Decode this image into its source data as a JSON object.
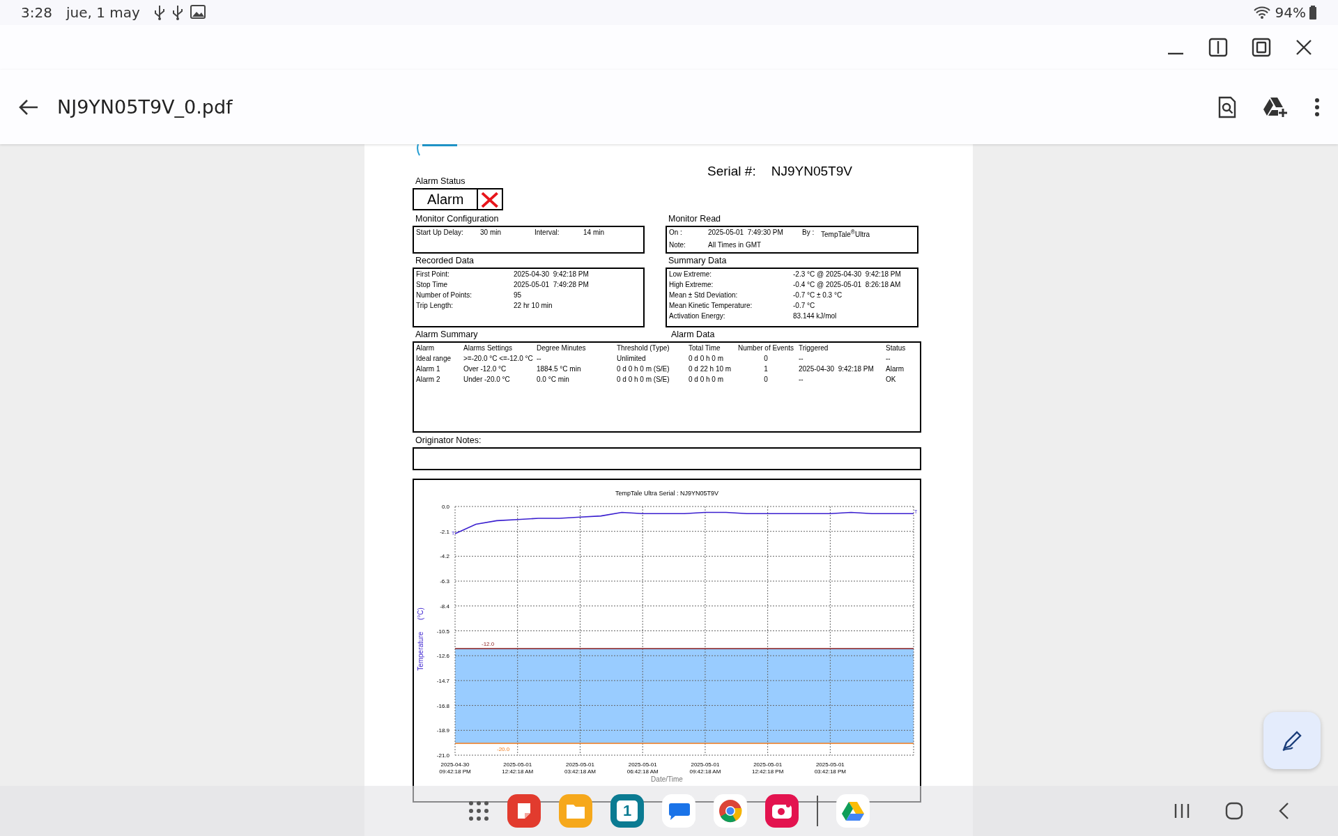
{
  "status_bar": {
    "time": "3:28",
    "date": "jue, 1 may",
    "battery": "94%"
  },
  "toolbar": {
    "title": "NJ9YN05T9V_0.pdf"
  },
  "document": {
    "serial_label": "Serial #:",
    "serial": "NJ9YN05T9V",
    "alarm_status": {
      "heading": "Alarm Status",
      "value": "Alarm"
    },
    "panels": [
      {
        "heading": "Monitor Configuration",
        "rows": [
          [
            {
              "label": "Start Up Delay:",
              "value": "30 min"
            },
            {
              "label": "Interval:",
              "value": "14 min"
            }
          ]
        ]
      },
      {
        "heading": "Monitor Read",
        "rows": [
          [
            {
              "label": "On :",
              "value": "2025-05-01  7:49:30 PM"
            },
            {
              "label": "By :",
              "value": "TempTale$^{®}$Ultra"
            }
          ],
          [
            {
              "label": "Note:",
              "value": "All Times in GMT"
            }
          ]
        ]
      },
      {
        "heading": "Recorded Data",
        "rows": [
          [
            {
              "label": "First Point:",
              "value": "2025-04-30  9:42:18 PM"
            }
          ],
          [
            {
              "label": "Stop Time",
              "value": "2025-05-01  7:49:28 PM"
            }
          ],
          [
            {
              "label": "Number of Points:",
              "value": "95"
            }
          ],
          [
            {
              "label": "Trip Length:",
              "value": "22 hr 10 min"
            }
          ]
        ]
      },
      {
        "heading": "Summary Data",
        "rows": [
          [
            {
              "label": "Low Extreme:",
              "value": "-2.3 °C @ 2025-04-30  9:42:18 PM"
            }
          ],
          [
            {
              "label": "High Extreme:",
              "value": "-0.4 °C @ 2025-05-01  8:26:18 AM"
            }
          ],
          [
            {
              "label": "Mean ± Std Deviation:",
              "value": "-0.7 °C ± 0.3 °C"
            }
          ],
          [
            {
              "label": "Mean Kinetic Temperature:",
              "value": "-0.7 °C"
            }
          ],
          [
            {
              "label": "Activation Energy:",
              "value": "83.144 kJ/mol"
            }
          ]
        ]
      }
    ],
    "alarm_summary": {
      "heading": "Alarm Summary",
      "heading_2": "Alarm Data",
      "columns": [
        "Alarm",
        "Alarms Settings",
        "Degree Minutes",
        "Threshold (Type)",
        "Total Time",
        "Number of Events",
        "Triggered",
        "Status"
      ],
      "rows": [
        [
          "Ideal range",
          ">=-20.0 °C <=-12.0 °C",
          "--",
          "Unlimited",
          "0 d 0 h 0 m",
          "0",
          "--",
          "--"
        ],
        [
          "Alarm 1",
          "Over -12.0 °C",
          "1884.5 °C min",
          "0 d 0 h 0 m (S/E)",
          "0 d 22 h 10 m",
          "1",
          "2025-04-30  9:42:18 PM",
          "Alarm"
        ],
        [
          "Alarm 2",
          "Under -20.0 °C",
          "0.0 °C min",
          "0 d 0 h 0 m (S/E)",
          "0 d 0 h 0 m",
          "0",
          "--",
          "OK"
        ]
      ]
    },
    "notes": {
      "heading": "Originator Notes:"
    },
    "chart": {
      "chart_data": {
        "type": "line",
        "title": "TempTale Ultra  Serial : NJ9YN05T9V",
        "ylabel": "Temperature      (°C)",
        "xlabel": "Date/Time",
        "categories": [
          "2025-04-30 09:42:18 PM",
          null,
          null,
          "2025-05-01 12:42:18 AM",
          null,
          null,
          "2025-05-01 03:42:18 AM",
          null,
          null,
          "2025-05-01 06:42:18 AM",
          null,
          null,
          "2025-05-01 09:42:18 AM",
          null,
          null,
          "2025-05-01 12:42:18 PM",
          null,
          null,
          "2025-05-01 03:42:18 PM",
          null,
          null,
          null,
          null
        ],
        "ylim": [
          -21,
          0
        ],
        "yticks": [
          {
            "value": 0,
            "label": "0.0"
          },
          {
            "value": -2.1,
            "label": "-2.1"
          },
          {
            "value": -4.2,
            "label": "-4.2"
          },
          {
            "value": -6.3,
            "label": "-6.3"
          },
          {
            "value": -8.4,
            "label": "-8.4"
          },
          {
            "value": -10.5,
            "label": "-10.5"
          },
          {
            "value": -12.6,
            "label": "-12.6"
          },
          {
            "value": -14.7,
            "label": "-14.7"
          },
          {
            "value": -16.8,
            "label": "-16.8"
          },
          {
            "value": -18.9,
            "label": "-18.9"
          },
          {
            "value": -21,
            "label": "-21.0"
          }
        ],
        "series": [
          {
            "name": "T",
            "color": "#3a1fcf",
            "values": [
              -2.3,
              -1.5,
              -1.2,
              -1.1,
              -1.0,
              -1.0,
              -0.9,
              -0.8,
              -0.5,
              -0.6,
              -0.6,
              -0.6,
              -0.5,
              -0.5,
              -0.6,
              -0.6,
              -0.6,
              -0.6,
              -0.6,
              -0.5,
              -0.6,
              -0.6,
              -0.6
            ]
          }
        ],
        "grid": true,
        "ref_lines": [
          {
            "axis": "y",
            "value": -12.0,
            "label": "-12.0",
            "color": "#8b1c1c"
          },
          {
            "axis": "y",
            "value": -20.0,
            "label": "-20.0",
            "color": "#f07a1a"
          }
        ],
        "bands": [
          {
            "axis": "y",
            "from": -20.0,
            "to": -12.0,
            "color": "#99ccff"
          }
        ]
      }
    }
  },
  "taskbar": {
    "apps": [
      {
        "kind": "notes"
      },
      {
        "kind": "files"
      },
      {
        "kind": "calendar",
        "text": "1"
      },
      {
        "kind": "messages"
      },
      {
        "kind": "browser"
      },
      {
        "kind": "camera"
      },
      {
        "kind": "drive"
      }
    ]
  }
}
